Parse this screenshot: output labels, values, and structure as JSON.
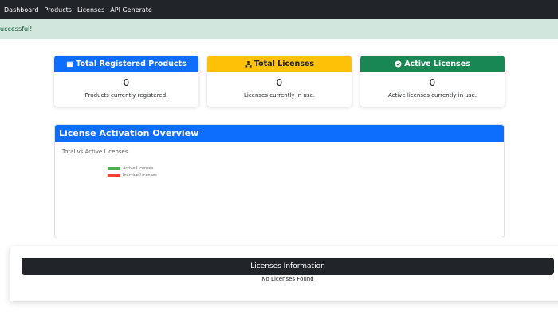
{
  "nav": {
    "items": [
      "Dashboard",
      "Products",
      "Licenses",
      "API Generate"
    ]
  },
  "alert": {
    "text": "uccessful!"
  },
  "cards": [
    {
      "title": "Total Registered Products",
      "value": "0",
      "text": "Products currently registered.",
      "icon": "calendar-icon",
      "color": "#0d6efd"
    },
    {
      "title": "Total Licenses",
      "value": "0",
      "text": "Licenses currently in use.",
      "icon": "users-icon",
      "color": "#ffc107"
    },
    {
      "title": "Active Licenses",
      "value": "0",
      "text": "Active licenses currently in use.",
      "icon": "check-circle-icon",
      "color": "#198754"
    }
  ],
  "chart": {
    "title": "License Activation Overview",
    "subtitle": "Total vs Active Licenses"
  },
  "chart_data": {
    "type": "bar",
    "title": "",
    "series": [
      {
        "name": "Active Licenses",
        "values": [],
        "color": "#4caf50"
      },
      {
        "name": "Inactive Licenses",
        "values": [],
        "color": "#f44336"
      }
    ]
  },
  "licenses": {
    "title": "Licenses Information",
    "empty_text": "No Licenses Found"
  }
}
